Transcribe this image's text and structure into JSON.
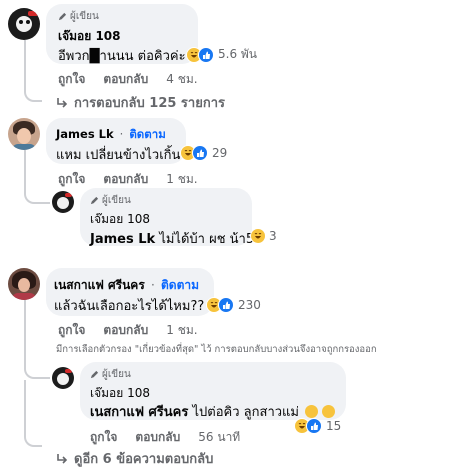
{
  "comments": [
    {
      "author_badge": "ผู้เขียน",
      "name": "เจ๊มอย 108",
      "text": "อีพวก█านนน ต่อคิวค่ะ",
      "reaction_count": "5.6 พัน",
      "like": "ถูกใจ",
      "reply": "ตอบกลับ",
      "time": "4 ชม."
    },
    {
      "name": "James Lk",
      "follow": "ติดตาม",
      "separator": "·",
      "text": "แหม เปลี่ยนข้างไวเกิ้น",
      "reaction_count": "29",
      "like": "ถูกใจ",
      "reply": "ตอบกลับ",
      "time": "1 ชม."
    },
    {
      "author_badge": "ผู้เขียน",
      "name": "เจ๊มอย 108",
      "mention": "James Lk",
      "text": "ไม่ได้บ้า ผช น้า55",
      "reaction_count": "3"
    },
    {
      "name": "เนสกาแฟ ศรีนคร",
      "follow": "ติดตาม",
      "separator": "·",
      "text": "แล้วฉันเลือกอะไรได้ไหม??",
      "reaction_count": "230",
      "like": "ถูกใจ",
      "reply": "ตอบกลับ",
      "time": "1 ชม."
    },
    {
      "author_badge": "ผู้เขียน",
      "name": "เจ๊มอย 108",
      "mention": "เนสกาแฟ ศรีนคร",
      "text": "ไปต่อคิว ลูกสาวแม่",
      "reaction_count": "15",
      "like": "ถูกใจ",
      "reply": "ตอบกลับ",
      "time": "56 นาที"
    }
  ],
  "more_replies_1": "การตอบกลับ 125 รายการ",
  "filter_notice": "มีการเลือกตัวกรอง \"เกี่ยวข้องที่สุด\" ไว้ การตอบกลับบางส่วนจึงอาจถูกกรองออก",
  "more_replies_2": "ดูอีก 6 ข้อความตอบกลับ",
  "colors": {
    "bubble": "#f0f2f5",
    "link": "#0866ff",
    "muted": "#65676b"
  },
  "icons": [
    "pencil-icon",
    "haha-reaction-icon",
    "like-reaction-icon",
    "reply-arrow-icon",
    "rolling-eyes-emoji"
  ]
}
